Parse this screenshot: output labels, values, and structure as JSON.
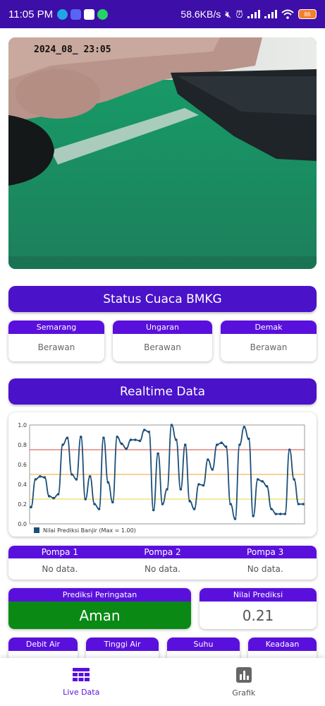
{
  "status_bar": {
    "time": "11:05 PM",
    "net_speed": "58.6KB/s",
    "battery": "86"
  },
  "camera": {
    "timestamp": "2024_08_  23:05"
  },
  "weather": {
    "title": "Status Cuaca BMKG",
    "cities": [
      {
        "name": "Semarang",
        "status": "Berawan"
      },
      {
        "name": "Ungaran",
        "status": "Berawan"
      },
      {
        "name": "Demak",
        "status": "Berawan"
      }
    ]
  },
  "realtime": {
    "title": "Realtime Data"
  },
  "chart_data": {
    "type": "line",
    "legend": "Nilai Prediksi Banjir (Max = 1.00)",
    "ylim": [
      0,
      1
    ],
    "yticks": [
      "0.0",
      "0.2",
      "0.4",
      "0.6",
      "0.8",
      "1.0"
    ],
    "thresholds": [
      {
        "value": 0.75,
        "color": "#d44a3a"
      },
      {
        "value": 0.5,
        "color": "#f0a030"
      },
      {
        "value": 0.25,
        "color": "#e8d23a"
      }
    ],
    "series_color": "#1c4f7a",
    "values": [
      0.17,
      0.45,
      0.48,
      0.47,
      0.28,
      0.26,
      0.3,
      0.8,
      0.87,
      0.5,
      0.45,
      0.88,
      0.25,
      0.48,
      0.2,
      0.15,
      0.87,
      0.42,
      0.22,
      0.88,
      0.81,
      0.76,
      0.85,
      0.85,
      0.84,
      0.95,
      0.93,
      0.14,
      0.71,
      0.2,
      0.35,
      1.0,
      0.85,
      0.35,
      0.8,
      0.23,
      0.15,
      0.4,
      0.39,
      0.65,
      0.55,
      0.8,
      0.82,
      0.78,
      0.2,
      0.05,
      0.8,
      0.98,
      0.86,
      0.08,
      0.45,
      0.43,
      0.38,
      0.15,
      0.1,
      0.1,
      0.1,
      0.75,
      0.45,
      0.2,
      0.2
    ]
  },
  "pompa": {
    "headers": [
      "Pompa 1",
      "Pompa 2",
      "Pompa 3"
    ],
    "values": [
      "No data.",
      "No data.",
      "No data."
    ]
  },
  "prediksi": {
    "peringatan_label": "Prediksi Peringatan",
    "peringatan_value": "Aman",
    "nilai_label": "Nilai Prediksi",
    "nilai_value": "0.21",
    "peringatan_color": "#0a8a14"
  },
  "sensors": [
    "Debit Air",
    "Tinggi Air",
    "Suhu",
    "Keadaan"
  ],
  "nav": {
    "items": [
      {
        "label": "Live Data",
        "icon": "table-icon",
        "active": true
      },
      {
        "label": "Grafik",
        "icon": "bar-chart-icon",
        "active": false
      }
    ]
  },
  "colors": {
    "accent": "#4a12c9",
    "status_bar": "#3d0ea8"
  }
}
